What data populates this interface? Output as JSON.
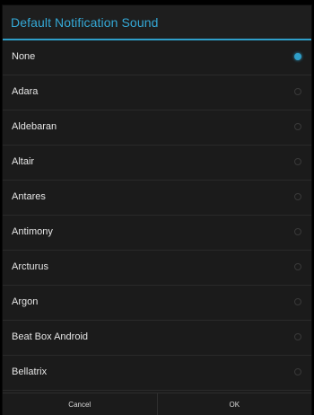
{
  "dialog": {
    "title": "Default Notification Sound",
    "accent_color": "#2f9fc9",
    "items": [
      {
        "label": "None",
        "selected": true
      },
      {
        "label": "Adara",
        "selected": false
      },
      {
        "label": "Aldebaran",
        "selected": false
      },
      {
        "label": "Altair",
        "selected": false
      },
      {
        "label": "Antares",
        "selected": false
      },
      {
        "label": "Antimony",
        "selected": false
      },
      {
        "label": "Arcturus",
        "selected": false
      },
      {
        "label": "Argon",
        "selected": false
      },
      {
        "label": "Beat Box Android",
        "selected": false
      },
      {
        "label": "Bellatrix",
        "selected": false
      }
    ],
    "buttons": {
      "cancel_label": "Cancel",
      "ok_label": "OK"
    }
  }
}
